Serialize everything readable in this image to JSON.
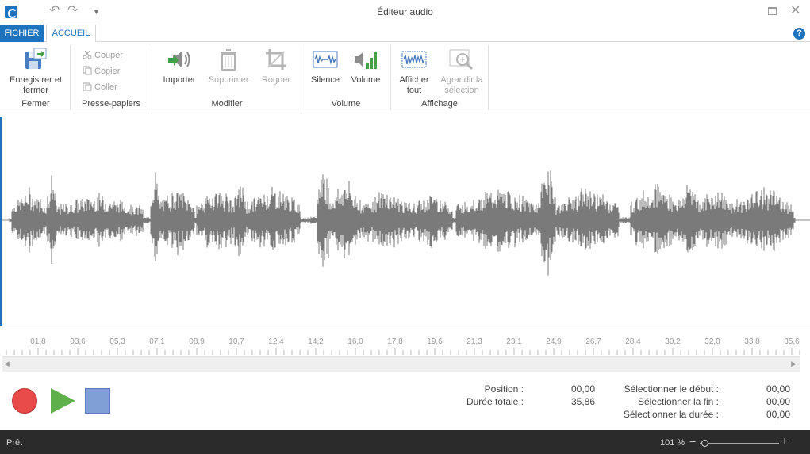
{
  "window": {
    "title": "Éditeur audio",
    "undo_icon": "undo-icon",
    "redo_icon": "redo-icon"
  },
  "tabs": [
    {
      "label": "FICHIER",
      "active": false
    },
    {
      "label": "ACCUEIL",
      "active": true
    }
  ],
  "ribbon": {
    "fermer": {
      "label": "Fermer",
      "save_close": "Enregistrer et fermer"
    },
    "presse_papiers": {
      "label": "Presse-papiers",
      "couper": "Couper",
      "copier": "Copier",
      "coller": "Coller"
    },
    "modifier": {
      "label": "Modifier",
      "importer": "Importer",
      "supprimer": "Supprimer",
      "rogner": "Rogner"
    },
    "volume": {
      "label": "Volume",
      "silence": "Silence",
      "volume": "Volume"
    },
    "affichage": {
      "label": "Affichage",
      "afficher_tout": "Afficher tout",
      "agrandir": "Agrandir la sélection"
    }
  },
  "timeline": {
    "ticks": [
      "01,8",
      "03,6",
      "05,3",
      "07,1",
      "08,9",
      "10,7",
      "12,4",
      "14,2",
      "16,0",
      "17,8",
      "19,6",
      "21,3",
      "23,1",
      "24,9",
      "26,7",
      "28,4",
      "30,2",
      "32,0",
      "33,8",
      "35,6"
    ]
  },
  "info": {
    "position_label": "Position :",
    "position_value": "00,00",
    "total_label": "Durée totale :",
    "total_value": "35,86",
    "sel_start_label": "Sélectionner le début :",
    "sel_start_value": "00,00",
    "sel_end_label": "Sélectionner la fin :",
    "sel_end_value": "00,00",
    "sel_dur_label": "Sélectionner la durée :",
    "sel_dur_value": "00,00"
  },
  "status": {
    "text": "Prêt",
    "zoom": "101 %"
  },
  "colors": {
    "accent": "#1e73be",
    "waveform": "#7a7a7a",
    "record": "#e94b4b",
    "play": "#5eb04a",
    "stop": "#7f9fd6"
  }
}
